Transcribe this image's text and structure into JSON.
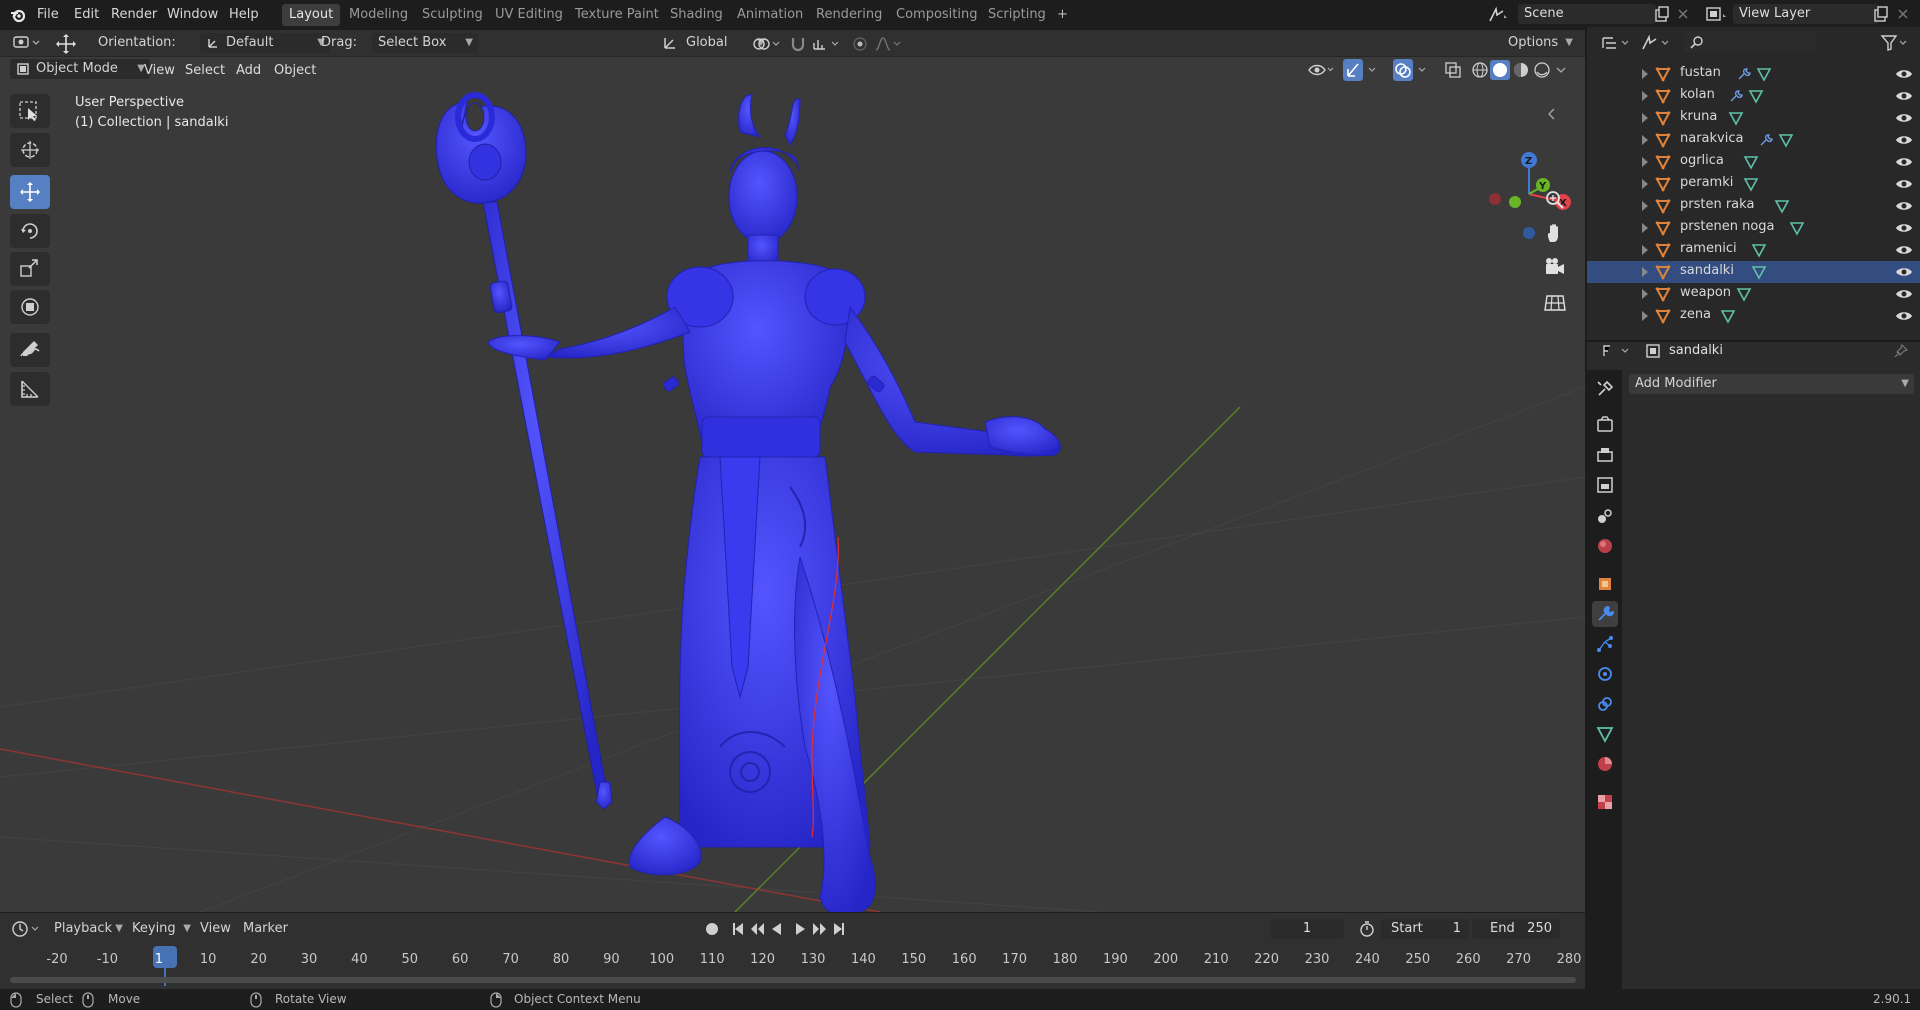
{
  "menubar": {
    "items": [
      "File",
      "Edit",
      "Render",
      "Window",
      "Help"
    ],
    "workspaces": [
      "Layout",
      "Modeling",
      "Sculpting",
      "UV Editing",
      "Texture Paint",
      "Shading",
      "Animation",
      "Rendering",
      "Compositing",
      "Scripting"
    ],
    "active_workspace": "Layout",
    "add_tab": "+",
    "scene": "Scene",
    "view_layer": "View Layer"
  },
  "toolheader": {
    "orientation_label": "Orientation:",
    "orientation_value": "Default",
    "drag_label": "Drag:",
    "drag_value": "Select Box",
    "transform_orientation": "Global",
    "options": "Options"
  },
  "viewport": {
    "mode": "Object Mode",
    "menus": [
      "View",
      "Select",
      "Add",
      "Object"
    ],
    "perspective": "User Perspective",
    "collection_info": "(1) Collection | sandalki"
  },
  "outliner": {
    "items": [
      {
        "name": "fustan",
        "mod": true
      },
      {
        "name": "kolan",
        "mod": true
      },
      {
        "name": "kruna",
        "mod": false
      },
      {
        "name": "narakvica",
        "mod": true
      },
      {
        "name": "ogrlica",
        "mod": false
      },
      {
        "name": "peramki",
        "mod": false
      },
      {
        "name": "prsten raka",
        "mod": false
      },
      {
        "name": "prstenen noga",
        "mod": false
      },
      {
        "name": "ramenici",
        "mod": false
      },
      {
        "name": "sandalki",
        "mod": false
      },
      {
        "name": "weapon",
        "mod": false
      },
      {
        "name": "zena",
        "mod": false
      }
    ],
    "selected": "sandalki"
  },
  "properties": {
    "object_name": "sandalki",
    "add_modifier": "Add Modifier"
  },
  "timeline": {
    "menus": [
      "Playback",
      "Keying",
      "View",
      "Marker"
    ],
    "current_frame": "1",
    "start_label": "Start",
    "start": "1",
    "end_label": "End",
    "end": "250",
    "ruler": [
      "-20",
      "-10",
      "1",
      "10",
      "20",
      "30",
      "40",
      "50",
      "60",
      "70",
      "80",
      "90",
      "100",
      "110",
      "120",
      "130",
      "140",
      "150",
      "160",
      "170",
      "180",
      "190",
      "200",
      "210",
      "220",
      "230",
      "240",
      "250",
      "260",
      "270",
      "280"
    ]
  },
  "statusbar": {
    "select": "Select",
    "move": "Move",
    "rotate": "Rotate View",
    "context": "Object Context Menu",
    "version": "2.90.1"
  },
  "colors": {
    "accent": "#5680c2",
    "model": "#3b3bf0",
    "x_axis": "#a83a3a",
    "y_axis": "#6b8f2a",
    "gizmo_x": "#e0414a",
    "gizmo_y": "#69b526",
    "gizmo_z": "#4079d6",
    "object_orange": "#e0833a",
    "mesh_green": "#5ec2a8"
  }
}
